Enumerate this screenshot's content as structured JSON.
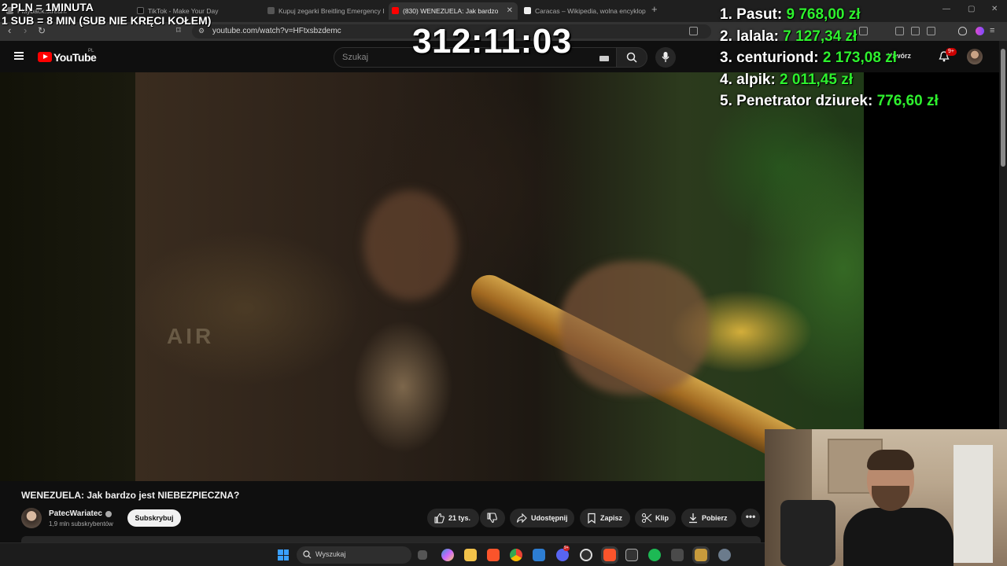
{
  "browser": {
    "tabs": [
      {
        "label": "2 PLN = 1MINUTA",
        "favicon": "tab-favicon-generic"
      },
      {
        "label": "TikTok - Make Your Day",
        "favicon": "tiktok-icon"
      },
      {
        "label": "Kupuj zegarki Breitling Emergency I",
        "favicon": "shop-icon"
      },
      {
        "label": "(830) WENEZUELA: Jak bardzo",
        "favicon": "youtube-icon",
        "active": true
      },
      {
        "label": "Caracas – Wikipedia, wolna encyklop",
        "favicon": "wikipedia-icon"
      }
    ],
    "new_tab": "+",
    "url": "youtube.com/watch?v=HFtxsbzdemc",
    "window_controls": [
      "—",
      "▢",
      "✕"
    ]
  },
  "youtube": {
    "logo_text": "YouTube",
    "region": "PL",
    "search_placeholder": "Szukaj",
    "login_label": "Utwórz",
    "notification_count": "9+"
  },
  "overlay": {
    "rules": [
      "2 PLN = 1MINUTA",
      "1 SUB = 8 MIN (SUB NIE KRĘCI KOŁEM)"
    ],
    "timer": "312:11:03",
    "leaderboard": [
      {
        "rank": "1.",
        "name": "Pasut:",
        "amount": "9 768,00 zł"
      },
      {
        "rank": "2.",
        "name": "lalala:",
        "amount": "7 127,34 zł"
      },
      {
        "rank": "3.",
        "name": "centuriond:",
        "amount": "2 173,08 zł"
      },
      {
        "rank": "4.",
        "name": "alpik:",
        "amount": "2 011,45 zł"
      },
      {
        "rank": "5.",
        "name": "Penetrator dziurek:",
        "amount": "776,60 zł"
      }
    ],
    "colors": {
      "amount": "#2ef02e",
      "name": "#ffffff"
    }
  },
  "video": {
    "title": "WENEZUELA: Jak bardzo jest NIEBEZPIECZNA?",
    "channel": "PatecWariatec",
    "subscribers": "1,9 mln subskrybentów",
    "subscribe_label": "Subskrybuj",
    "likes": "21 tys.",
    "share_label": "Udostępnij",
    "save_label": "Zapisz",
    "clip_label": "Klip",
    "download_label": "Pobierz",
    "more_label": "•••",
    "frame_text": "AIR"
  },
  "taskbar": {
    "search_label": "Wyszukaj",
    "apps": [
      "task-view-icon",
      "copilot-icon",
      "file-explorer-icon",
      "brave-icon",
      "chrome-icon",
      "store-icon",
      "discord-icon",
      "obs-icon",
      "brave-beta-icon",
      "faceit-icon",
      "spotify-icon",
      "calculator-icon",
      "league-icon",
      "settings-icon"
    ]
  }
}
